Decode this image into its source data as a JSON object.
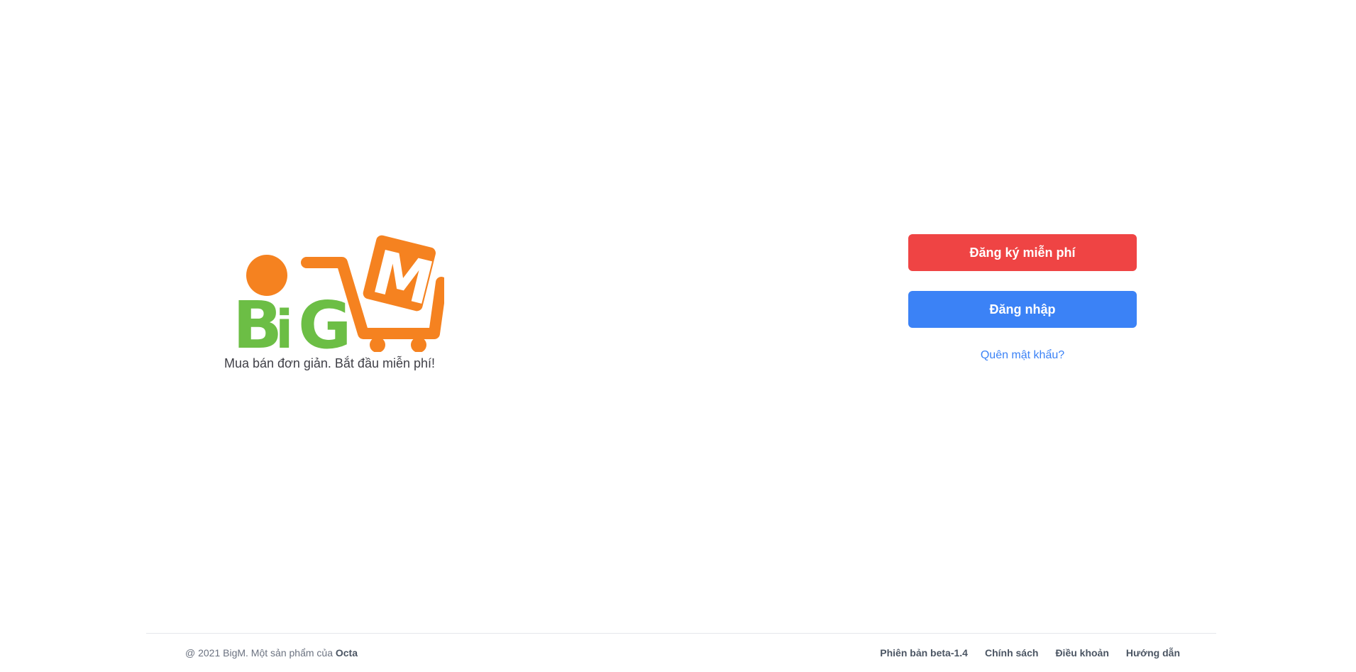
{
  "brand": {
    "logo_text": "BiGM",
    "tagline": "Mua bán đơn giản. Bắt đầu miễn phí!",
    "colors": {
      "green": "#6cbe45",
      "orange": "#f58220"
    }
  },
  "auth": {
    "register_label": "Đăng ký miễn phí",
    "login_label": "Đăng nhập",
    "forgot_label": "Quên mật khẩu?",
    "colors": {
      "register": "#ef4444",
      "login": "#3b82f6"
    }
  },
  "footer": {
    "copyright_prefix": "@ 2021 BigM. Một sản phẩm của",
    "copyright_owner": "Octa",
    "version": "Phiên bản beta-1.4",
    "links": [
      "Chính sách",
      "Điều khoản",
      "Hướng dẫn"
    ]
  }
}
